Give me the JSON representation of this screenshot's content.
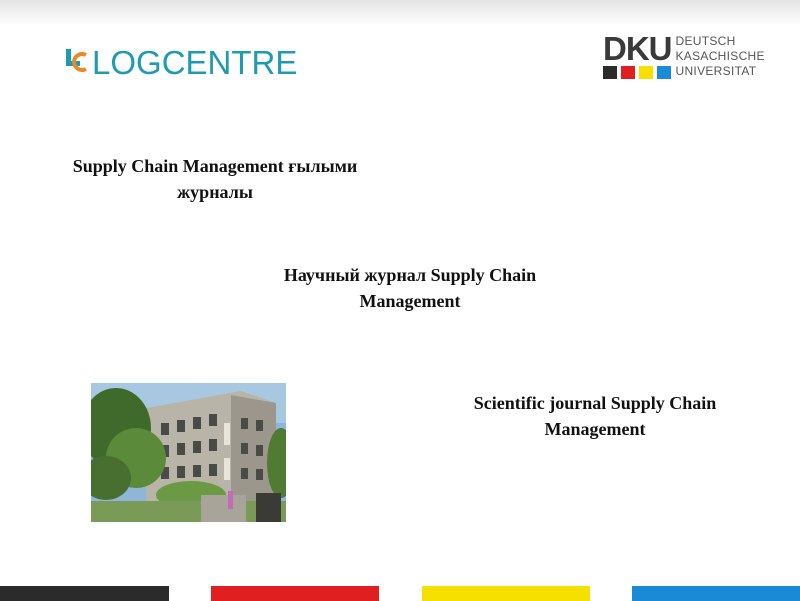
{
  "logos": {
    "logcentre": {
      "text": "LOGCENTRE",
      "color": "#1e9bb0",
      "accent": "#e88a2a"
    },
    "dku": {
      "letters": "DKU",
      "lines": [
        "DEUTSCH",
        "KASACHISCHE",
        "UNIVERSITAT"
      ],
      "square_colors": [
        "#2b2b2b",
        "#e02020",
        "#f5e000",
        "#1a8ad6"
      ]
    }
  },
  "headings": {
    "kazakh": [
      "Supply Chain Management ғылыми",
      "журналы"
    ],
    "russian": [
      "Научный журнал Supply Chain",
      "Management"
    ],
    "english": [
      "Scientific journal Supply Chain",
      "Management"
    ]
  },
  "photo": {
    "icon": "university-building-photo"
  },
  "footer_bar_colors": [
    "#2b2b2b",
    "#e02020",
    "#f5e000",
    "#1a8ad6"
  ]
}
